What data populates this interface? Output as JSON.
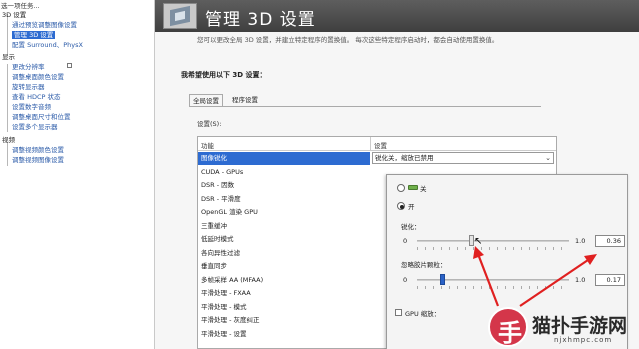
{
  "tree": {
    "title": "选一项任务...",
    "items": [
      {
        "label": "3D 设置",
        "kind": "category"
      },
      {
        "label": "通过预览调整图像设置",
        "kind": "link"
      },
      {
        "label": "管理 3D 设置",
        "kind": "selected"
      },
      {
        "label": "配置 Surround、PhysX",
        "kind": "link"
      },
      {
        "label": "显示",
        "kind": "category"
      },
      {
        "label": "更改分辨率",
        "kind": "link"
      },
      {
        "label": "调整桌面颜色设置",
        "kind": "link"
      },
      {
        "label": "旋转显示器",
        "kind": "link"
      },
      {
        "label": "查看 HDCP 状态",
        "kind": "link"
      },
      {
        "label": "设置数字音频",
        "kind": "link"
      },
      {
        "label": "调整桌面尺寸和位置",
        "kind": "link"
      },
      {
        "label": "设置多个显示器",
        "kind": "link"
      },
      {
        "label": "视频",
        "kind": "category"
      },
      {
        "label": "调整视频颜色设置",
        "kind": "link"
      },
      {
        "label": "调整视频图像设置",
        "kind": "link"
      }
    ]
  },
  "header": {
    "title": "管理 3D 设置",
    "logo_icon": "nvidia-3d-settings-icon"
  },
  "description": "您可以更改全局 3D 设置，并建立特定程序的置换值。 每次这些特定程序启动时，都会自动使用置换值。",
  "section_title": "我希望使用以下 3D 设置：",
  "tabs": [
    {
      "label": "全局设置",
      "active": true
    },
    {
      "label": "程序设置",
      "active": false
    }
  ],
  "settings_label": "设置(S):",
  "table": {
    "col_feature": "功能",
    "col_setting": "设置",
    "features": [
      "图像锐化",
      "CUDA - GPUs",
      "DSR - 因数",
      "DSR - 平滑度",
      "OpenGL 渲染 GPU",
      "三重缓冲",
      "低延时模式",
      "各向异性过滤",
      "垂直同步",
      "多帧采样 AA (MFAA)",
      "平滑处理 - FXAA",
      "平滑处理 - 模式",
      "平滑处理 - 灰度纠正",
      "平滑处理 - 设置"
    ],
    "selected_index": 0,
    "selected_value": "锐化关，缩放已禁用"
  },
  "popup": {
    "off_label": "关",
    "on_label": "开",
    "on_selected": true,
    "sharpen": {
      "label": "锐化：",
      "min": "0",
      "max": "1.0",
      "value": "0.36",
      "value_num": 0.36
    },
    "ignore_grain": {
      "label": "忽略胶片颗粒：",
      "min": "0",
      "max": "1.0",
      "value": "0.17",
      "value_num": 0.17
    },
    "gpu_scaling_label": "GPU 缩放：",
    "gpu_scaling_checked": false
  },
  "annotation_color": "#e02020",
  "watermark": {
    "badge_char": "手",
    "text": "猫扑手游网",
    "url": "njxhmpc.com"
  }
}
